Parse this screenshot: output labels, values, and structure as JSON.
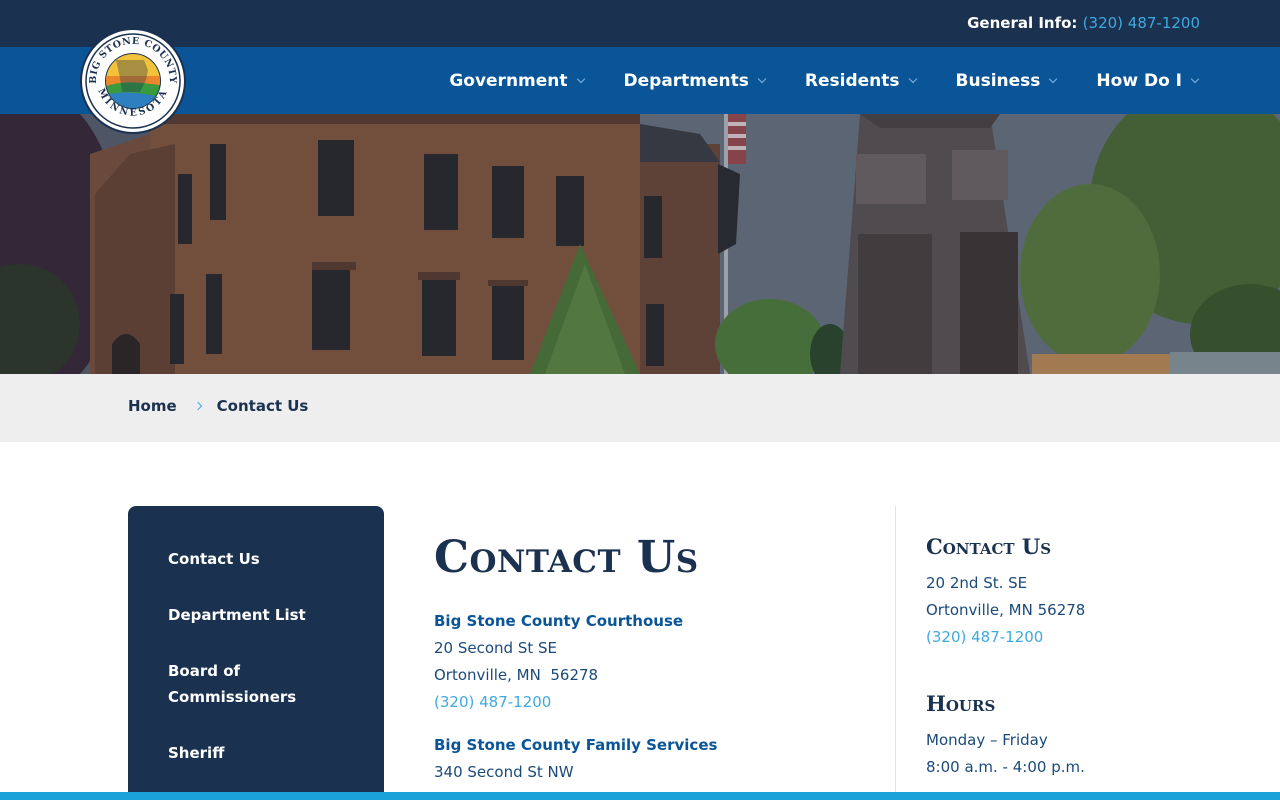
{
  "topbar": {
    "label": "General Info:",
    "phone": "(320) 487-1200"
  },
  "logo": {
    "ring_text_top": "BIG STONE COUNTY",
    "ring_text_bottom": "MINNESOTA"
  },
  "nav": {
    "items": [
      {
        "label": "Government"
      },
      {
        "label": "Departments"
      },
      {
        "label": "Residents"
      },
      {
        "label": "Business"
      },
      {
        "label": "How Do I"
      }
    ]
  },
  "breadcrumb": {
    "home": "Home",
    "current": "Contact Us"
  },
  "sidebar": {
    "items": [
      {
        "label": "Contact Us"
      },
      {
        "label": "Department List"
      },
      {
        "label": "Board of Commissioners"
      },
      {
        "label": "Sheriff"
      }
    ]
  },
  "main": {
    "title": "Contact Us",
    "locations": [
      {
        "name": "Big Stone County Courthouse",
        "address1": "20 Second St SE",
        "address2": "Ortonville, MN  56278",
        "phone": "(320) 487-1200"
      },
      {
        "name": "Big Stone County Family Services",
        "address1": "340 Second St NW"
      }
    ]
  },
  "aside": {
    "contact_heading": "Contact Us",
    "contact_address1": "20 2nd St. SE",
    "contact_address2": "Ortonville, MN 56278",
    "contact_phone": "(320) 487-1200",
    "hours_heading": "Hours",
    "hours_days": "Monday – Friday",
    "hours_time": "8:00 a.m. - 4:00 p.m."
  },
  "colors": {
    "topbar": "#1a3150",
    "navbar": "#0a5598",
    "accent": "#3fa9e0",
    "sidebar": "#1a3150",
    "breadcrumb_bg": "#eeeeee",
    "stripe": "#19a3d9"
  }
}
